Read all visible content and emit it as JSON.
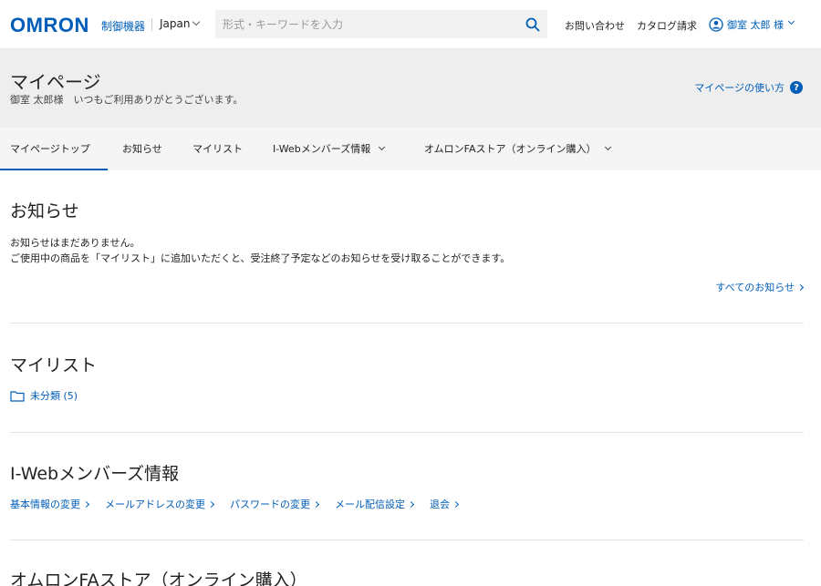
{
  "header": {
    "logo": "OMRON",
    "brand_sub": "制御機器",
    "region": "Japan",
    "search_placeholder": "形式・キーワードを入力",
    "links": {
      "contact": "お問い合わせ",
      "catalog": "カタログ請求"
    },
    "user_name": "御室 太郎 様"
  },
  "banner": {
    "title": "マイページ",
    "greeting": "御室 太郎様　いつもご利用ありがとうございます。",
    "howto": "マイページの使い方"
  },
  "tabs": [
    {
      "label": "マイページトップ",
      "active": true
    },
    {
      "label": "お知らせ"
    },
    {
      "label": "マイリスト"
    },
    {
      "label": "I-Webメンバーズ情報"
    },
    {
      "label": "オムロンFAストア（オンライン購入）"
    }
  ],
  "notice": {
    "title": "お知らせ",
    "line1": "お知らせはまだありません。",
    "line2": "ご使用中の商品を「マイリスト」に追加いただくと、受注終了予定などのお知らせを受け取ることができます。",
    "all_link": "すべてのお知らせ"
  },
  "mylist": {
    "title": "マイリスト",
    "folder": "未分類 (5)"
  },
  "members": {
    "title": "I-Webメンバーズ情報",
    "links": [
      "基本情報の変更",
      "メールアドレスの変更",
      "パスワードの変更",
      "メール配信設定",
      "退会"
    ]
  },
  "store": {
    "title": "オムロンFAストア（オンライン購入）"
  },
  "colors": {
    "brand": "#005eb8",
    "banner_bg": "#eeeeee",
    "tabs_bg": "#f5f5f5"
  }
}
